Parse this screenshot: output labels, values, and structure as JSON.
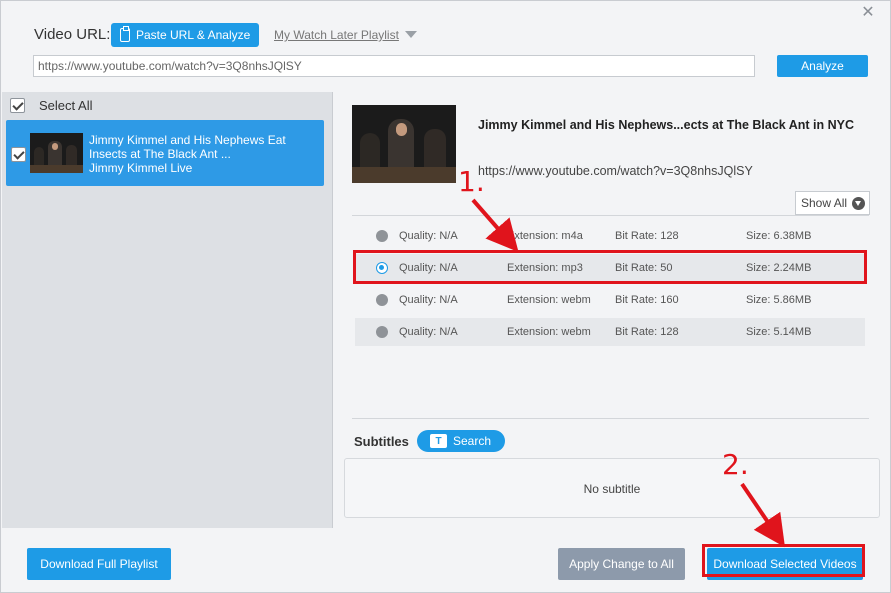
{
  "toolbar": {
    "video_url_label": "Video URL:",
    "paste_button_label": "Paste URL & Analyze",
    "watch_later_label": "My Watch Later Playlist",
    "url_value": "https://www.youtube.com/watch?v=3Q8nhsJQlSY",
    "analyze_label": "Analyze"
  },
  "sidebar": {
    "select_all_label": "Select All",
    "items": [
      {
        "title": "Jimmy Kimmel and His Nephews Eat Insects at The Black Ant ...",
        "channel": "Jimmy Kimmel Live",
        "checked": true
      }
    ]
  },
  "detail": {
    "title": "Jimmy Kimmel and His Nephews...ects at The Black Ant in NYC",
    "url": "https://www.youtube.com/watch?v=3Q8nhsJQlSY",
    "show_all_label": "Show All",
    "formats": [
      {
        "quality": "Quality: N/A",
        "extension": "Extension: m4a",
        "bitrate": "Bit Rate: 128",
        "size": "Size: 6.38MB",
        "selected": false
      },
      {
        "quality": "Quality: N/A",
        "extension": "Extension: mp3",
        "bitrate": "Bit Rate: 50",
        "size": "Size: 2.24MB",
        "selected": true
      },
      {
        "quality": "Quality: N/A",
        "extension": "Extension: webm",
        "bitrate": "Bit Rate: 160",
        "size": "Size: 5.86MB",
        "selected": false
      },
      {
        "quality": "Quality: N/A",
        "extension": "Extension: webm",
        "bitrate": "Bit Rate: 128",
        "size": "Size: 5.14MB",
        "selected": false
      }
    ],
    "subtitles_label": "Subtitles",
    "search_label": "Search",
    "no_subtitle": "No subtitle"
  },
  "footer": {
    "download_playlist_label": "Download Full Playlist",
    "apply_change_label": "Apply Change to All",
    "download_selected_label": "Download Selected Videos"
  },
  "annotations": {
    "step1": "1.",
    "step2": "2."
  },
  "colors": {
    "accent": "#1e9be6",
    "annotation": "#e0141c",
    "disabled_button": "#8d9aab"
  }
}
